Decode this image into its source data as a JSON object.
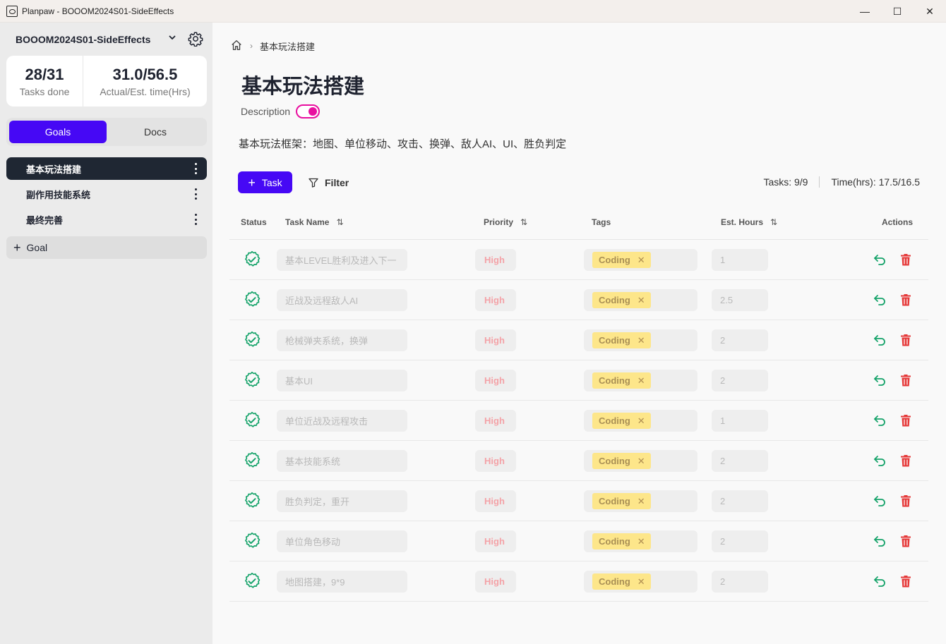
{
  "window": {
    "title": "Planpaw - BOOOM2024S01-SideEffects",
    "controls": [
      "—",
      "☐",
      "✕"
    ]
  },
  "sidebar": {
    "project_name": "BOOOM2024S01-SideEffects",
    "stats": [
      {
        "value": "28/31",
        "label": "Tasks done"
      },
      {
        "value": "31.0/56.5",
        "label": "Actual/Est. time(Hrs)"
      }
    ],
    "tabs": [
      {
        "label": "Goals",
        "active": true
      },
      {
        "label": "Docs",
        "active": false
      }
    ],
    "goals": [
      {
        "label": "基本玩法搭建",
        "active": true
      },
      {
        "label": "副作用技能系统",
        "active": false
      },
      {
        "label": "最终完善",
        "active": false
      }
    ],
    "add_goal_label": "Goal"
  },
  "main": {
    "breadcrumb": {
      "current": "基本玩法搭建"
    },
    "title": "基本玩法搭建",
    "description_label": "Description",
    "description_toggle_on": true,
    "description_text": "基本玩法框架：地图、单位移动、攻击、换弹、敌人AI、UI、胜负判定",
    "add_task_label": "Task",
    "filter_label": "Filter",
    "tasks_summary": "Tasks: 9/9",
    "time_summary": "Time(hrs): 17.5/16.5",
    "columns": {
      "status": "Status",
      "name": "Task Name",
      "priority": "Priority",
      "tags": "Tags",
      "hours": "Est. Hours",
      "actions": "Actions"
    },
    "tasks": [
      {
        "name": "基本LEVEL胜利及进入下一",
        "priority": "High",
        "tag": "Coding",
        "hours": "1"
      },
      {
        "name": "近战及远程敌人AI",
        "priority": "High",
        "tag": "Coding",
        "hours": "2.5"
      },
      {
        "name": "枪械弹夹系统，换弹",
        "priority": "High",
        "tag": "Coding",
        "hours": "2"
      },
      {
        "name": "基本UI",
        "priority": "High",
        "tag": "Coding",
        "hours": "2"
      },
      {
        "name": "单位近战及远程攻击",
        "priority": "High",
        "tag": "Coding",
        "hours": "1"
      },
      {
        "name": "基本技能系统",
        "priority": "High",
        "tag": "Coding",
        "hours": "2"
      },
      {
        "name": "胜负判定，重开",
        "priority": "High",
        "tag": "Coding",
        "hours": "2"
      },
      {
        "name": "单位角色移动",
        "priority": "High",
        "tag": "Coding",
        "hours": "2"
      },
      {
        "name": "地图搭建，9*9",
        "priority": "High",
        "tag": "Coding",
        "hours": "2"
      }
    ]
  },
  "colors": {
    "accent": "#4608f5",
    "toggle": "#e80f9f",
    "done_green": "#16a36a",
    "delete_red": "#e53939",
    "tag_bg": "#fde68a"
  }
}
